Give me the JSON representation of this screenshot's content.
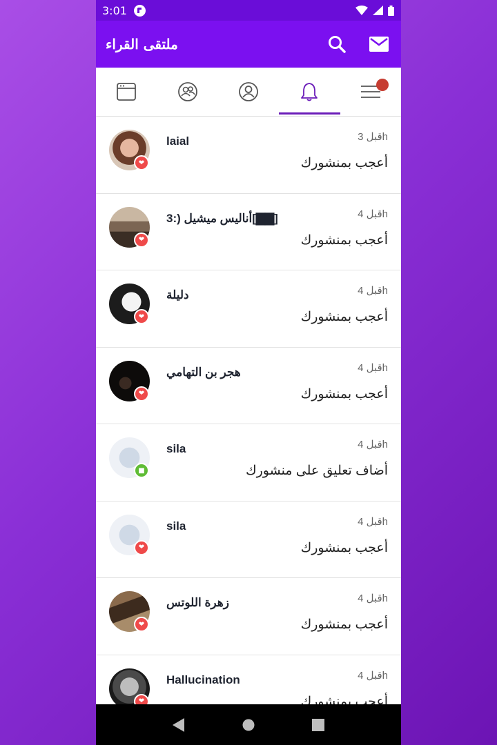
{
  "status_bar": {
    "time": "3:01"
  },
  "app_bar": {
    "title": "ملتقى القراء"
  },
  "tabs": [
    {
      "icon": "browser-window-icon",
      "active": false
    },
    {
      "icon": "friends-icon",
      "active": false
    },
    {
      "icon": "profile-icon",
      "active": false
    },
    {
      "icon": "bell-icon",
      "active": true
    },
    {
      "icon": "menu-icon",
      "active": false,
      "has_dot": true
    }
  ],
  "notifications": [
    {
      "name": "laial",
      "time": "قبل 3h",
      "action": "أعجب بمنشورك",
      "type": "like"
    },
    {
      "name": "أناليس ميشيل (:3[▇▇]",
      "time": "قبل 4h",
      "action": "أعجب بمنشورك",
      "type": "like"
    },
    {
      "name": "دليلة",
      "time": "قبل 4h",
      "action": "أعجب بمنشورك",
      "type": "like"
    },
    {
      "name": "هجر بن التهامي",
      "time": "قبل 4h",
      "action": "أعجب بمنشورك",
      "type": "like"
    },
    {
      "name": "sila",
      "time": "قبل 4h",
      "action": "أضاف تعليق على منشورك",
      "type": "comment"
    },
    {
      "name": "sila",
      "time": "قبل 4h",
      "action": "أعجب بمنشورك",
      "type": "like"
    },
    {
      "name": "زهرة اللوتس",
      "time": "قبل 4h",
      "action": "أعجب بمنشورك",
      "type": "like"
    },
    {
      "name": "Hallucination",
      "time": "قبل 4h",
      "action": "أعجب بمنشورك",
      "type": "like"
    }
  ],
  "colors": {
    "status_bar": "#6a0dd8",
    "app_bar": "#7b10f0",
    "tab_indicator": "#6a1bb8",
    "like_badge": "#ef4a4a",
    "comment_badge": "#5fbc35",
    "menu_dot": "#c63d32"
  }
}
